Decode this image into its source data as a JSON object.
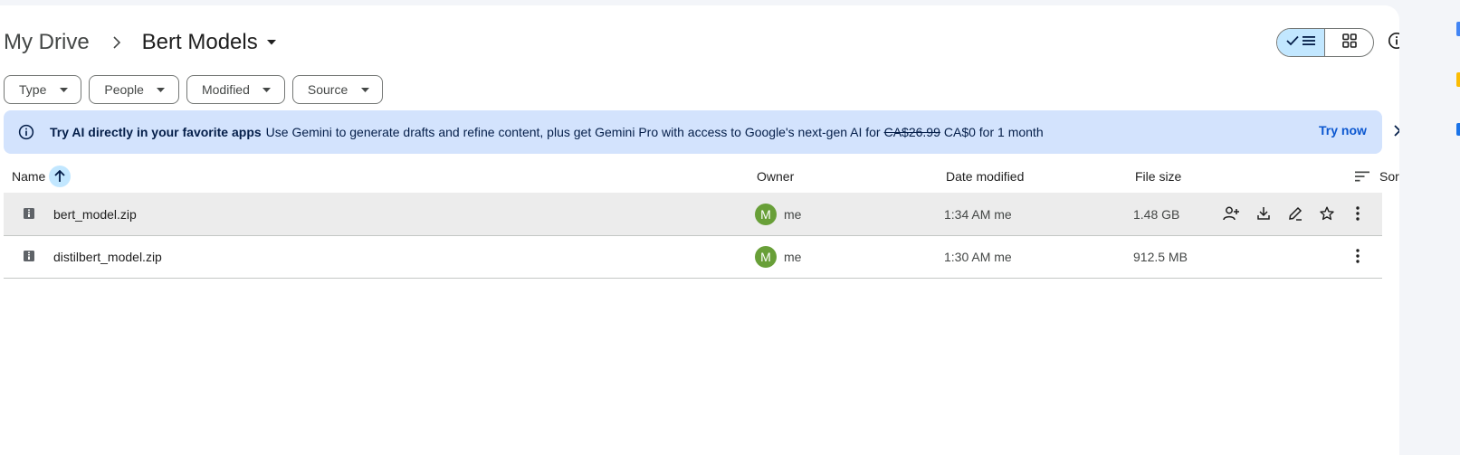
{
  "breadcrumb": {
    "root": "My Drive",
    "current": "Bert Models"
  },
  "filters": [
    {
      "label": "Type"
    },
    {
      "label": "People"
    },
    {
      "label": "Modified"
    },
    {
      "label": "Source"
    }
  ],
  "view_toggle": {
    "selected": "list"
  },
  "banner": {
    "title": "Try AI directly in your favorite apps",
    "text": "Use Gemini to generate drafts and refine content, plus get Gemini Pro with access to Google's next-gen AI for",
    "old_price": "CA$26.99",
    "new_price": "CA$0 for 1 month",
    "action": "Try now"
  },
  "table": {
    "columns": {
      "name": "Name",
      "owner": "Owner",
      "modified": "Date modified",
      "size": "File size",
      "sort": "Sort"
    },
    "sort_direction": "ascending",
    "rows": [
      {
        "name": "bert_model.zip",
        "owner_initial": "M",
        "owner": "me",
        "modified": "1:34 AM me",
        "size": "1.48 GB",
        "selected": true
      },
      {
        "name": "distilbert_model.zip",
        "owner_initial": "M",
        "owner": "me",
        "modified": "1:30 AM me",
        "size": "912.5 MB",
        "selected": false
      }
    ]
  },
  "colors": {
    "banner_bg": "#d3e3fd",
    "accent": "#0b57d0",
    "toggle_selected": "#c2e7ff",
    "avatar": "#689f38",
    "selected_row": "#ececec"
  }
}
